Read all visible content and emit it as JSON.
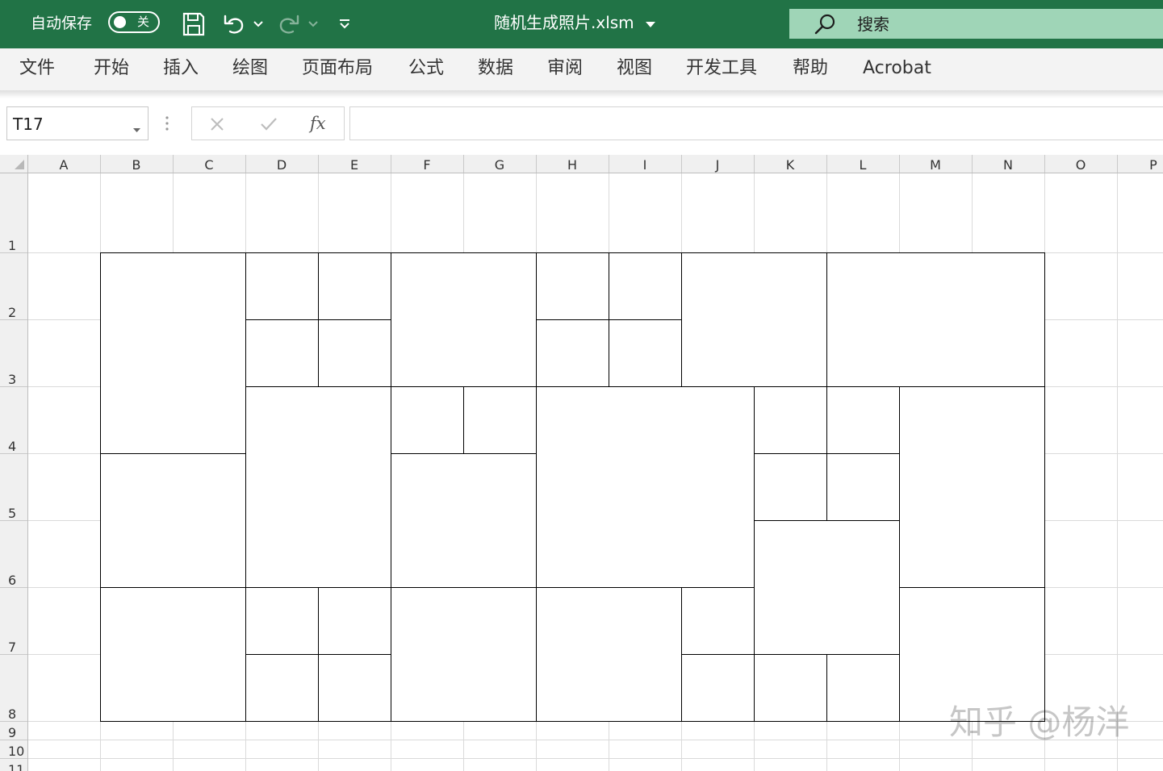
{
  "titlebar": {
    "autosave_label": "自动保存",
    "autosave_state": "关",
    "file_name": "随机生成照片.xlsm",
    "search_label": "搜索"
  },
  "ribbon": {
    "tabs": [
      "文件",
      "开始",
      "插入",
      "绘图",
      "页面布局",
      "公式",
      "数据",
      "审阅",
      "视图",
      "开发工具",
      "帮助",
      "Acrobat"
    ]
  },
  "formula_bar": {
    "name_box": "T17",
    "fx_label": "fx",
    "formula": ""
  },
  "sheet": {
    "columns": [
      "A",
      "B",
      "C",
      "D",
      "E",
      "F",
      "G",
      "H",
      "I",
      "J",
      "K",
      "L",
      "M",
      "N",
      "O",
      "P"
    ],
    "rows": [
      "1",
      "2",
      "3",
      "4",
      "5",
      "6",
      "7",
      "8",
      "9",
      "10",
      "11"
    ],
    "merged_regions": [
      {
        "range": "B2:C4"
      },
      {
        "range": "D2"
      },
      {
        "range": "E2"
      },
      {
        "range": "D3"
      },
      {
        "range": "E3"
      },
      {
        "range": "F2:G3"
      },
      {
        "range": "H2"
      },
      {
        "range": "I2"
      },
      {
        "range": "H3"
      },
      {
        "range": "I3"
      },
      {
        "range": "J2:K3"
      },
      {
        "range": "L2:N3"
      },
      {
        "range": "B5:C6"
      },
      {
        "range": "D4:E6"
      },
      {
        "range": "F4"
      },
      {
        "range": "G4"
      },
      {
        "range": "F5:G6"
      },
      {
        "range": "H4:J6"
      },
      {
        "range": "K4"
      },
      {
        "range": "L4"
      },
      {
        "range": "K5"
      },
      {
        "range": "L5"
      },
      {
        "range": "K6:L7"
      },
      {
        "range": "M4:N6"
      },
      {
        "range": "B7:C8"
      },
      {
        "range": "D7"
      },
      {
        "range": "E7"
      },
      {
        "range": "D8"
      },
      {
        "range": "E8"
      },
      {
        "range": "F7:G8"
      },
      {
        "range": "H7:I8"
      },
      {
        "range": "J7"
      },
      {
        "range": "J8"
      },
      {
        "range": "K8"
      },
      {
        "range": "L8"
      },
      {
        "range": "M7:N8"
      }
    ]
  },
  "watermark": "知乎 @杨洋"
}
